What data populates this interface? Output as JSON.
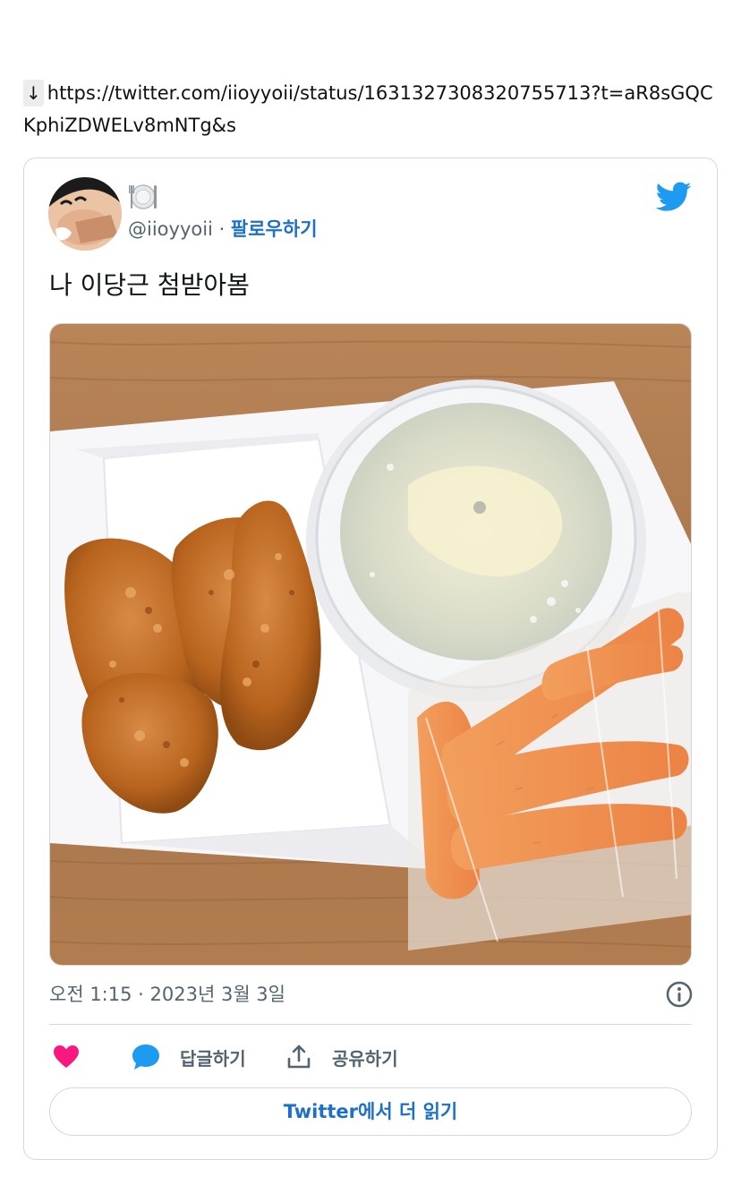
{
  "link": {
    "arrow": "↓",
    "url": "https://twitter.com/iioyyoii/status/1631327308320755713?t=aR8sGQCKphiZDWELv8mNTg&s"
  },
  "tweet": {
    "display_name_icon": "fork-and-knife-plate-icon",
    "handle": "@iioyyoii",
    "separator": " · ",
    "follow_label": "팔로우하기",
    "text": "나 이당근 첨받아봄",
    "time": "오전 1:15",
    "date": "2023년 3월 3일",
    "meta_separator": " · ",
    "reply_label": "답글하기",
    "share_label": "공유하기",
    "read_more_label": "Twitter에서 더 읽기"
  },
  "colors": {
    "link_blue": "#1d70c8",
    "twitter_blue": "#1d9bf0",
    "like_pink": "#f91880",
    "muted_text": "#536471",
    "border": "#cfd9de"
  }
}
